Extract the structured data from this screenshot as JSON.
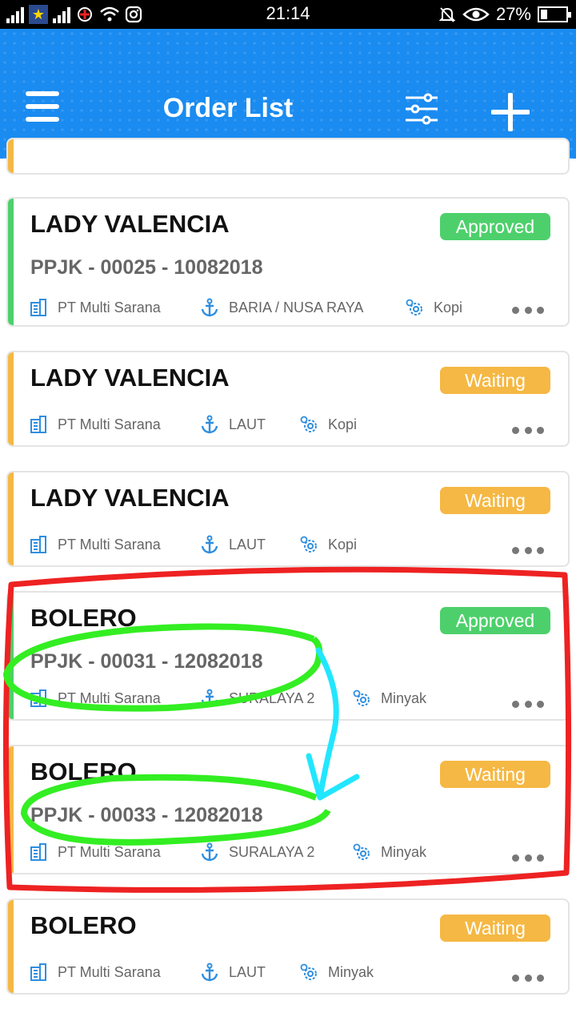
{
  "status_bar": {
    "time": "21:14",
    "battery": "27%"
  },
  "header": {
    "title": "Order List"
  },
  "partial_top_card": {
    "status_color": "#f5b844"
  },
  "colors": {
    "header_bg": "#1a8bf0",
    "approved": "#4dd06b",
    "waiting": "#f5b844",
    "icon_blue": "#2f8fe0",
    "annotation_red": "#ee2222",
    "annotation_green": "#33ee22",
    "annotation_cyan": "#22e6ff"
  },
  "orders": [
    {
      "vessel": "LADY VALENCIA",
      "code": "PPJK - 00025 - 10082018",
      "status": "Approved",
      "company": "PT Multi Sarana",
      "route": "BARIA / NUSA RAYA",
      "commodity": "Kopi"
    },
    {
      "vessel": "LADY VALENCIA",
      "code": "",
      "status": "Waiting",
      "company": "PT Multi Sarana",
      "route": "LAUT",
      "commodity": "Kopi"
    },
    {
      "vessel": "LADY VALENCIA",
      "code": "",
      "status": "Waiting",
      "company": "PT Multi Sarana",
      "route": "LAUT",
      "commodity": "Kopi"
    },
    {
      "vessel": "BOLERO",
      "code": "PPJK - 00031 - 12082018",
      "status": "Approved",
      "company": "PT Multi Sarana",
      "route": "SURALAYA 2",
      "commodity": "Minyak"
    },
    {
      "vessel": "BOLERO",
      "code": "PPJK - 00033 - 12082018",
      "status": "Waiting",
      "company": "PT Multi Sarana",
      "route": "SURALAYA 2",
      "commodity": "Minyak"
    },
    {
      "vessel": "BOLERO",
      "code": "",
      "status": "Waiting",
      "company": "PT Multi Sarana",
      "route": "LAUT",
      "commodity": "Minyak"
    }
  ]
}
